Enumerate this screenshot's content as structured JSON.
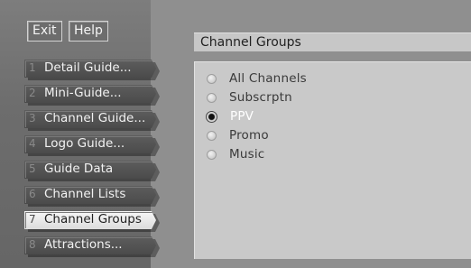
{
  "top_buttons": {
    "exit": "Exit",
    "help": "Help"
  },
  "menu": {
    "items": [
      {
        "num": "1",
        "label": "Detail Guide..."
      },
      {
        "num": "2",
        "label": "Mini-Guide..."
      },
      {
        "num": "3",
        "label": "Channel Guide..."
      },
      {
        "num": "4",
        "label": "Logo Guide..."
      },
      {
        "num": "5",
        "label": "Guide Data"
      },
      {
        "num": "6",
        "label": "Channel Lists"
      },
      {
        "num": "7",
        "label": "Channel Groups"
      },
      {
        "num": "8",
        "label": "Attractions..."
      }
    ],
    "active_index": 6
  },
  "panel": {
    "title": "Channel Groups",
    "options": [
      {
        "label": "All Channels",
        "selected": false
      },
      {
        "label": "Subscrptn",
        "selected": false
      },
      {
        "label": "PPV",
        "selected": true
      },
      {
        "label": "Promo",
        "selected": false
      },
      {
        "label": "Music",
        "selected": false
      }
    ]
  }
}
